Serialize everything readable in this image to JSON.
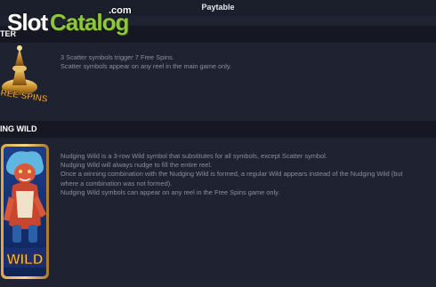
{
  "header": {
    "title": "Paytable"
  },
  "watermark": {
    "slot": "Slot",
    "catalog": "Catalog",
    "com": ".com"
  },
  "scatter": {
    "title": "TER",
    "symbol_text": "REE SPINS",
    "lines": [
      "3 Scatter symbols trigger 7 Free Spins.",
      "Scatter symbols appear on any reel in the main game only."
    ]
  },
  "wild": {
    "title": "ING WILD",
    "symbol_text": "WILD",
    "lines": [
      "Nudging Wild is a 3-row Wild symbol that substitutes for all symbols, except Scatter symbol.",
      "Nudging Wild will always nudge to fill the entire reel.",
      "Once a winning combination with the Nudging Wild is formed, a regular Wild appears instead of the Nudging Wild (but",
      "where a combination was not formed).",
      "Nudging Wild symbols can appear on any reel in the Free Spins game only."
    ]
  }
}
